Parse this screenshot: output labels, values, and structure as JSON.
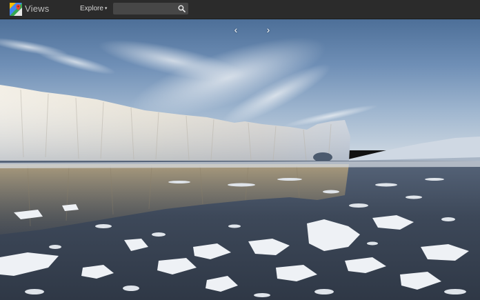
{
  "header": {
    "app_title": "Views",
    "explore_label": "Explore",
    "explore_caret": "▾",
    "search_placeholder": "",
    "search_value": ""
  },
  "icons": {
    "logo": "maps-logo-icon",
    "search": "search-icon",
    "prev": "chevron-left-icon",
    "next": "chevron-right-icon"
  },
  "pager": {
    "prev_glyph": "‹",
    "next_glyph": "›"
  },
  "colors": {
    "topbar": "#2b2b2b",
    "sky_top": "#5b7ea8",
    "sky_horizon": "#a9bfd6",
    "ice": "#ece9e2",
    "water": "#3b4656"
  }
}
